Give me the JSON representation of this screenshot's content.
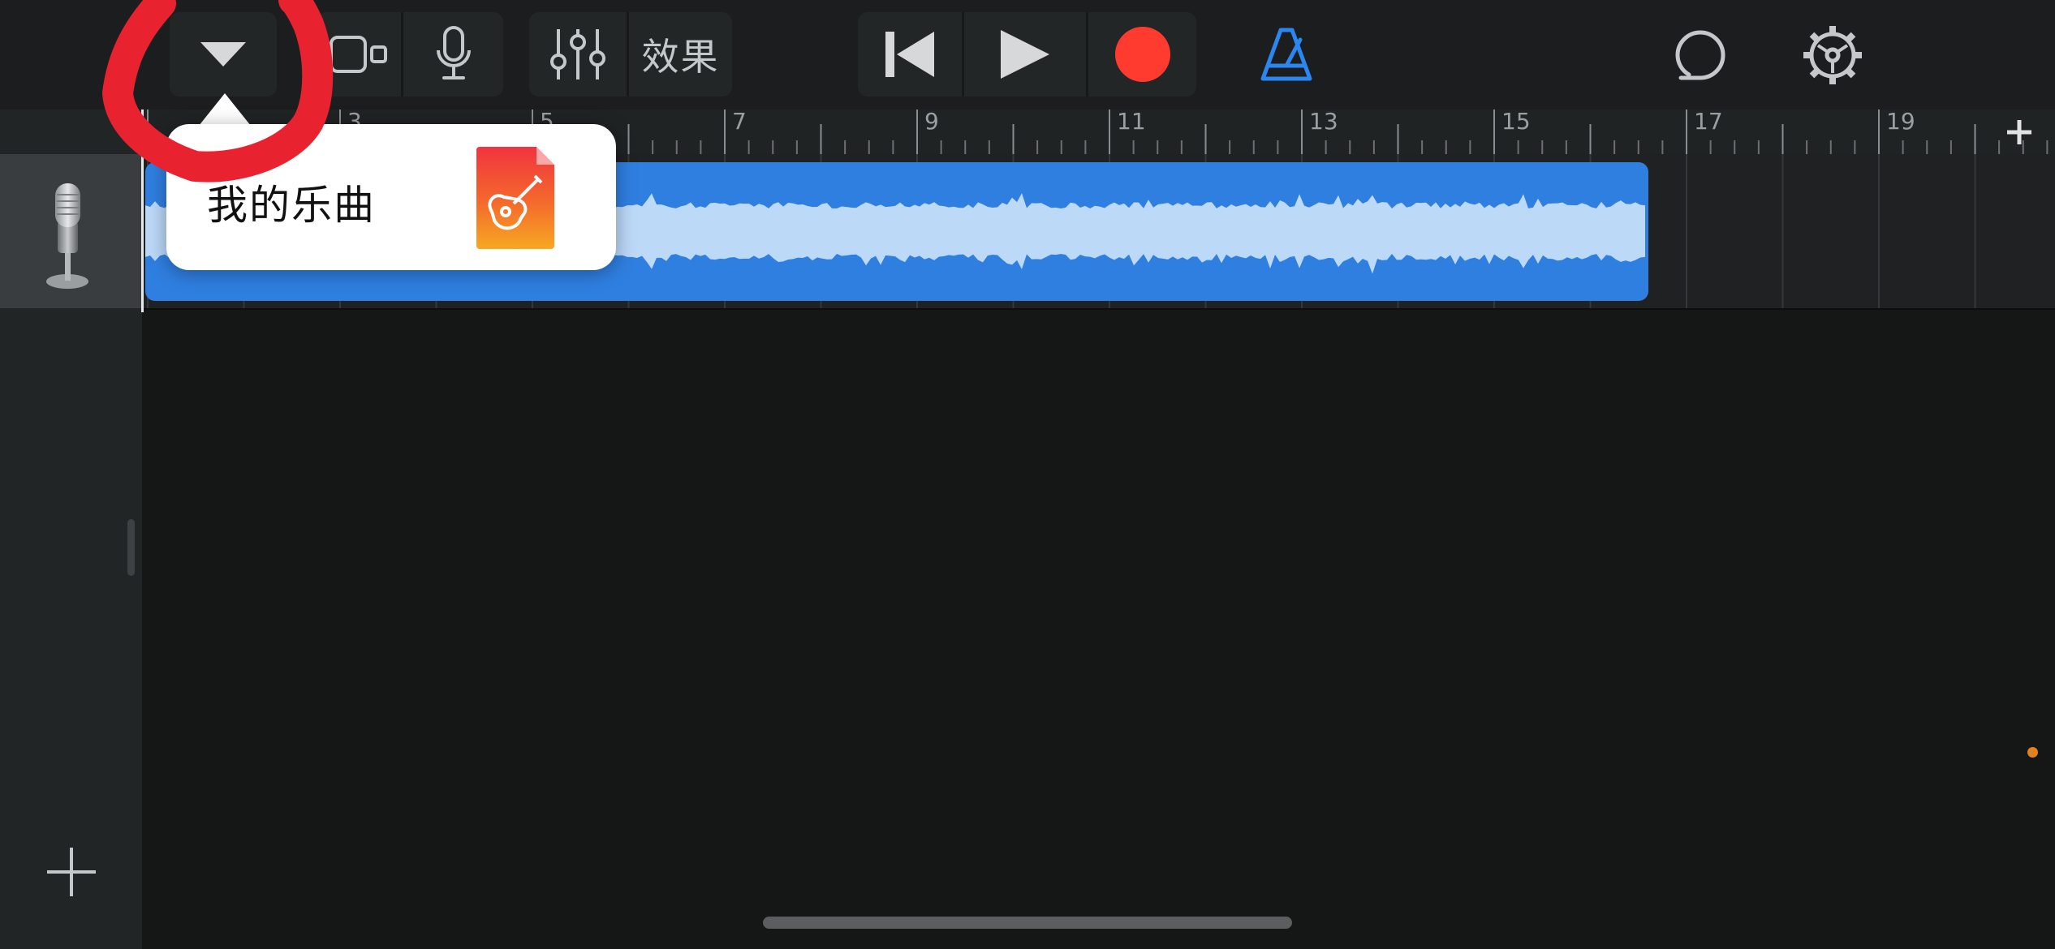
{
  "toolbar": {
    "browser_dropdown_icon": "chevron-down-icon",
    "track_view_icon": "track-view-icon",
    "mic_icon": "microphone-icon",
    "mixer_icon": "mixer-sliders-icon",
    "effects_label": "效果",
    "rewind_icon": "skip-back-icon",
    "play_icon": "play-icon",
    "record_icon": "record-icon",
    "metronome_icon": "metronome-icon",
    "loop_icon": "loop-icon",
    "settings_icon": "gear-icon"
  },
  "ruler": {
    "bar_labels": [
      "3",
      "5",
      "7",
      "9",
      "11",
      "13",
      "15",
      "17",
      "19"
    ],
    "add_section_icon": "plus-icon"
  },
  "track": {
    "name_icon": "microphone-icon",
    "region_color": "#2f7fe1",
    "wave_color": "#bcd9f8"
  },
  "popover": {
    "label": "我的乐曲",
    "app_icon": "garageband-app-icon"
  },
  "sidebar": {
    "add_track_icon": "plus-icon"
  },
  "colors": {
    "accent": "#2b86f0",
    "record": "#ff3b30",
    "annotation": "#e8232f",
    "indicator": "#e1821f"
  }
}
